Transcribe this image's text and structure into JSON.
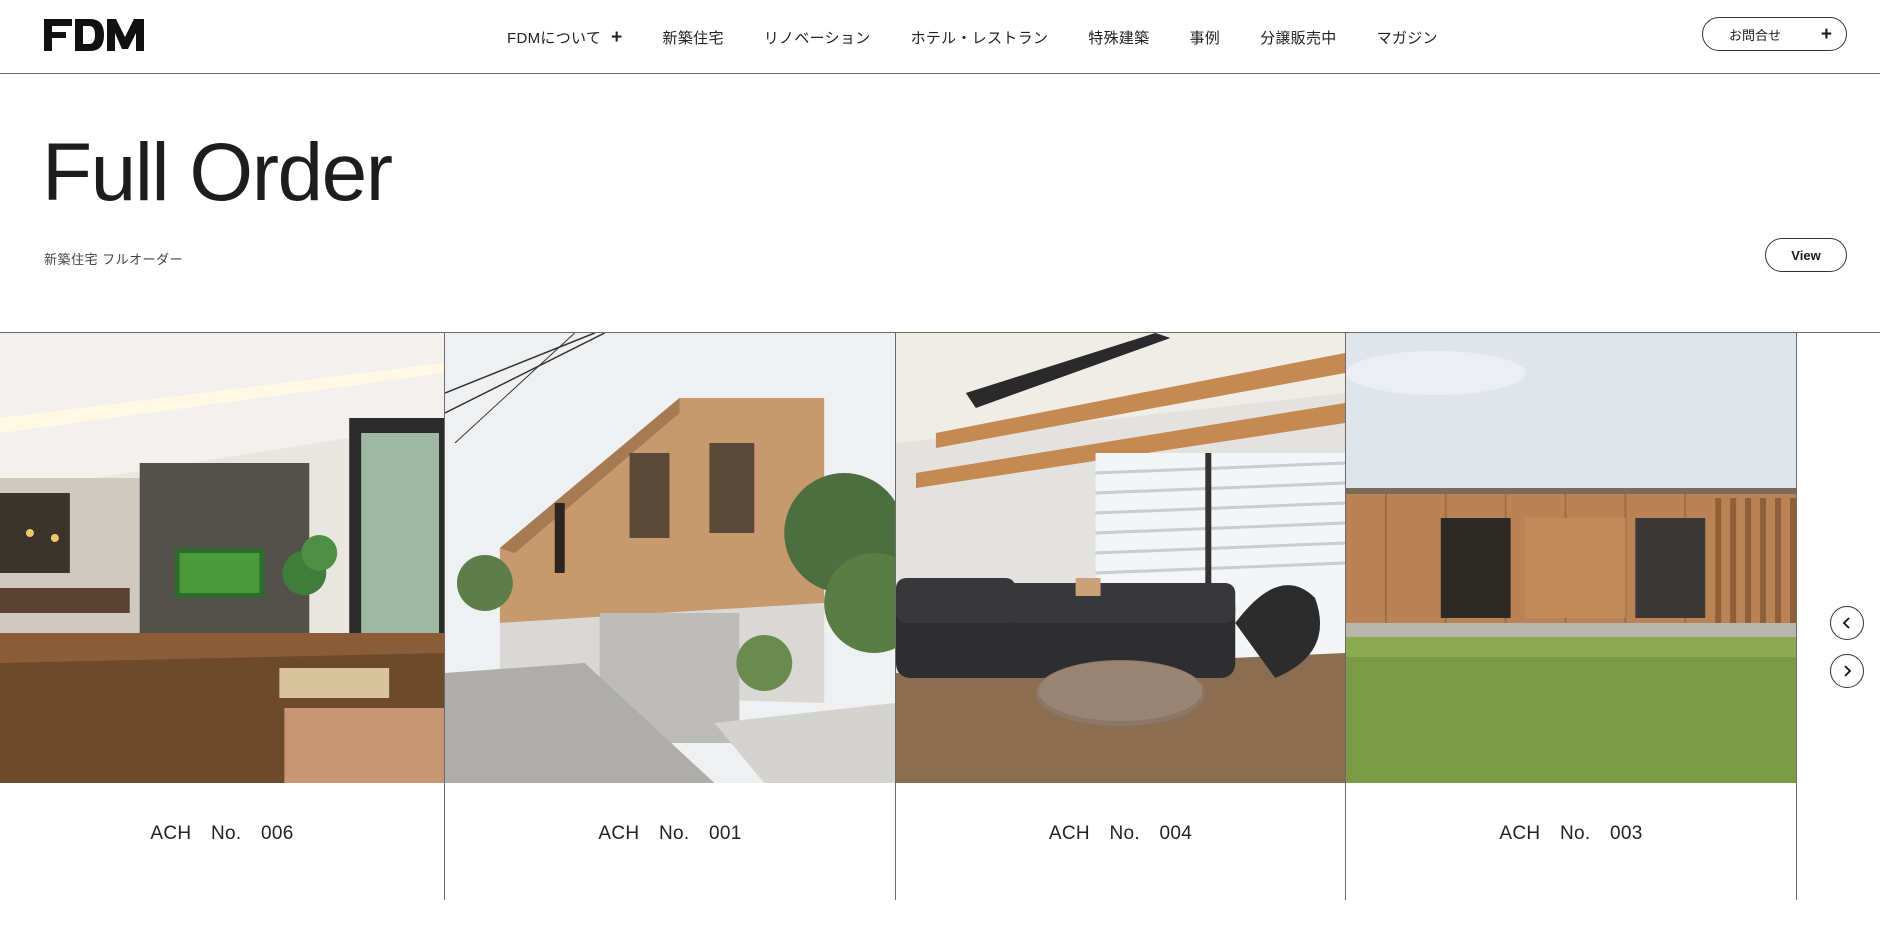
{
  "header": {
    "logo_text": "FDM",
    "nav": [
      {
        "label": "FDMについて",
        "has_plus": true
      },
      {
        "label": "新築住宅"
      },
      {
        "label": "リノベーション"
      },
      {
        "label": "ホテル・レストラン"
      },
      {
        "label": "特殊建築"
      },
      {
        "label": "事例"
      },
      {
        "label": "分譲販売中"
      },
      {
        "label": "マガジン"
      }
    ],
    "contact_label": "お問合せ"
  },
  "hero": {
    "title": "Full Order",
    "subtitle": "新築住宅 フルオーダー",
    "view_label": "View"
  },
  "gallery": {
    "cards": [
      {
        "label": "ACH No. 006",
        "image": "living-room-interior"
      },
      {
        "label": "ACH No. 001",
        "image": "wood-clad-house-exterior"
      },
      {
        "label": "ACH No. 004",
        "image": "living-room-sofa"
      },
      {
        "label": "ACH No. 003",
        "image": "wood-house-lawn"
      }
    ],
    "prev_icon": "chevron-left-icon",
    "next_icon": "chevron-right-icon"
  },
  "colors": {
    "text": "#1a1a1a",
    "border": "#6a6a6a",
    "background": "#ffffff"
  }
}
